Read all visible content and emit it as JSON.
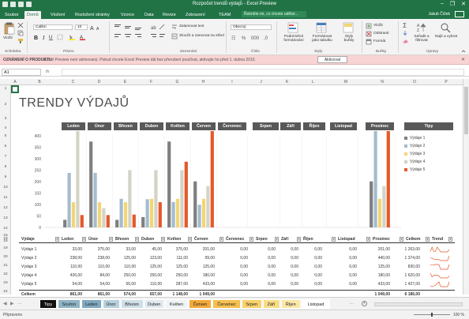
{
  "window": {
    "title": "Rozpočet trendů výdajů - Excel Preview",
    "minimize": "–",
    "restore": "❐",
    "close": "✕"
  },
  "ribbon_tabs": [
    "Soubor",
    "Domů",
    "Vložení",
    "Rozložení stránky",
    "Vzorce",
    "Data",
    "Revize",
    "Zobrazení",
    "TEAM"
  ],
  "active_tab": "Domů",
  "tell_me_placeholder": "Řekněte mi, co chcete udělat...",
  "user_name": "Jakub Čížek",
  "ribbon": {
    "paste_label": "Vložit",
    "font_name": "Calibri",
    "font_size": "10",
    "wrap_text": "Zalamovat text",
    "merge_center": "Sloučit a zarovnat na střed",
    "number_format": "Obecný",
    "cond_format": "Podmíněné formátování",
    "format_as_table": "Formátovat jako tabulku",
    "cell_styles": "Styly buňky",
    "insert": "Vložit",
    "delete": "Odstranit",
    "format": "Formát",
    "sort_filter": "Seřadit a filtrovat",
    "find_select": "Najít a vybrat",
    "groups": [
      "Schránka",
      "Písmo",
      "Zarovnání",
      "Číslo",
      "Styly",
      "Buňky",
      "Úpravy"
    ]
  },
  "notice": {
    "label": "OZNÁMENÍ O PRODUKTU",
    "message": "Excel Preview není aktivovaný. Pokud chcete Excel Preview dál bez přerušení používat, aktivujte ho před 1. dubna 2015.",
    "button": "Aktivovat",
    "close": "✕"
  },
  "formula_bar": {
    "name_box": "A1",
    "fx": "fx",
    "value": ""
  },
  "columns": [
    "A",
    "B",
    "C",
    "D",
    "E",
    "F",
    "G",
    "H",
    "I",
    "J",
    "K",
    "L",
    "M",
    "N",
    "O",
    "P"
  ],
  "rows": [
    "1",
    "2",
    "3",
    "4",
    "5",
    "6",
    "7",
    "8",
    "9",
    "10",
    "11",
    "12",
    "13",
    "14",
    "15",
    "16",
    "17",
    "18",
    "19",
    "20",
    "21",
    "22",
    "23",
    "24"
  ],
  "sheet_title": "TRENDY VÝDAJŮ",
  "months": [
    "Leden",
    "Únor",
    "Březen",
    "Duben",
    "Květen",
    "Červen",
    "Červenec",
    "Srpen",
    "Září",
    "Říjen",
    "Listopad",
    "Prosinec"
  ],
  "tips_header": "Tipy",
  "chart_data": {
    "type": "bar",
    "title": "",
    "categories": [
      "Leden",
      "Únor",
      "Březen",
      "Duben",
      "Květen",
      "Červen",
      "Červenec",
      "Srpen",
      "Září",
      "Říjen",
      "Listopad",
      "Prosinec"
    ],
    "series": [
      {
        "name": "Výdaje 1",
        "color": "#7f7f7f",
        "values": [
          33,
          375,
          33,
          45,
          375,
          201,
          0,
          0,
          0,
          0,
          0,
          201
        ]
      },
      {
        "name": "Výdaje 2",
        "color": "#a4bccd",
        "values": [
          238,
          238,
          125,
          123,
          111,
          99,
          0,
          0,
          0,
          0,
          0,
          440
        ]
      },
      {
        "name": "Výdaje 3",
        "color": "#f2d675",
        "values": [
          110,
          110,
          110,
          125,
          125,
          125,
          0,
          0,
          0,
          0,
          0,
          125
        ]
      },
      {
        "name": "Výdaje 4",
        "color": "#d3d3c6",
        "values": [
          426,
          84,
          250,
          250,
          250,
          180,
          0,
          0,
          0,
          0,
          0,
          180
        ]
      },
      {
        "name": "Výdaje 5",
        "color": "#e4592b",
        "values": [
          54,
          54,
          56,
          110,
          287,
          433,
          0,
          0,
          0,
          0,
          0,
          433
        ]
      }
    ],
    "ylim": [
      0,
      400
    ],
    "yticks": [
      "400",
      "350",
      "300",
      "250",
      "200",
      "150",
      "100",
      "50",
      "0"
    ],
    "grid": false,
    "legend": "right"
  },
  "table": {
    "headers": [
      "Výdaje",
      "Leden",
      "Únor",
      "Březen",
      "Duben",
      "Květen",
      "Červen",
      "Červenec",
      "Srpen",
      "Září",
      "Říjen",
      "Listopad",
      "Prosinec",
      "Celkem",
      "Trend"
    ],
    "rows": [
      {
        "label": "Výdaje 1",
        "values": [
          "33,00",
          "375,00",
          "33,00",
          "45,00",
          "375,00",
          "201,00",
          "0,00",
          "0,00",
          "0,00",
          "0,00",
          "0,00",
          "201,00",
          "1 263,00"
        ]
      },
      {
        "label": "Výdaje 2",
        "values": [
          "238,00",
          "238,00",
          "125,00",
          "123,00",
          "111,00",
          "99,00",
          "0,00",
          "0,00",
          "0,00",
          "0,00",
          "0,00",
          "440,00",
          "1 374,00"
        ]
      },
      {
        "label": "Výdaje 3",
        "values": [
          "110,00",
          "110,00",
          "110,00",
          "125,00",
          "125,00",
          "125,00",
          "0,00",
          "0,00",
          "0,00",
          "0,00",
          "0,00",
          "125,00",
          "830,00"
        ]
      },
      {
        "label": "Výdaje 4",
        "values": [
          "426,00",
          "84,00",
          "250,00",
          "250,00",
          "250,00",
          "180,00",
          "0,00",
          "0,00",
          "0,00",
          "0,00",
          "0,00",
          "180,00",
          "1 620,00"
        ]
      },
      {
        "label": "Výdaje 5",
        "values": [
          "54,00",
          "54,00",
          "56,00",
          "110,00",
          "287,00",
          "433,00",
          "0,00",
          "0,00",
          "0,00",
          "0,00",
          "0,00",
          "433,00",
          "1 427,00"
        ]
      }
    ],
    "total": {
      "label": "Celkem",
      "values": [
        "861,00",
        "861,00",
        "574,00",
        "657,00",
        "1 148,00",
        "1 049,00",
        "",
        "",
        "",
        "",
        "",
        "1 049,00",
        "6 186,00"
      ]
    }
  },
  "sheet_tabs": [
    {
      "label": "Tipy",
      "color": "#111111",
      "text": "#ffffff"
    },
    {
      "label": "Souhrn",
      "color": "#8eb4c4",
      "text": "#222222"
    },
    {
      "label": "Leden",
      "color": "#7fa9c0",
      "text": "#222222"
    },
    {
      "label": "Únor",
      "color": "#b7d0dc",
      "text": "#222222"
    },
    {
      "label": "Březen",
      "color": "#cfdfe8",
      "text": "#222222"
    },
    {
      "label": "Duben",
      "color": "#dfe9ef",
      "text": "#222222"
    },
    {
      "label": "Květen",
      "color": "#eef3f6",
      "text": "#222222"
    },
    {
      "label": "Červen",
      "color": "#f2a93b",
      "text": "#222222"
    },
    {
      "label": "Červenec",
      "color": "#f6c04f",
      "text": "#222222"
    },
    {
      "label": "Srpen",
      "color": "#f8d16c",
      "text": "#222222"
    },
    {
      "label": "Září",
      "color": "#f9dc87",
      "text": "#222222"
    },
    {
      "label": "Říjen",
      "color": "#fbe7a8",
      "text": "#222222"
    },
    {
      "label": "Listopad",
      "color": "#ffffff",
      "text": "#222222"
    }
  ],
  "sheet_more": "...",
  "status": "Připraveno",
  "zoom": "100 %"
}
